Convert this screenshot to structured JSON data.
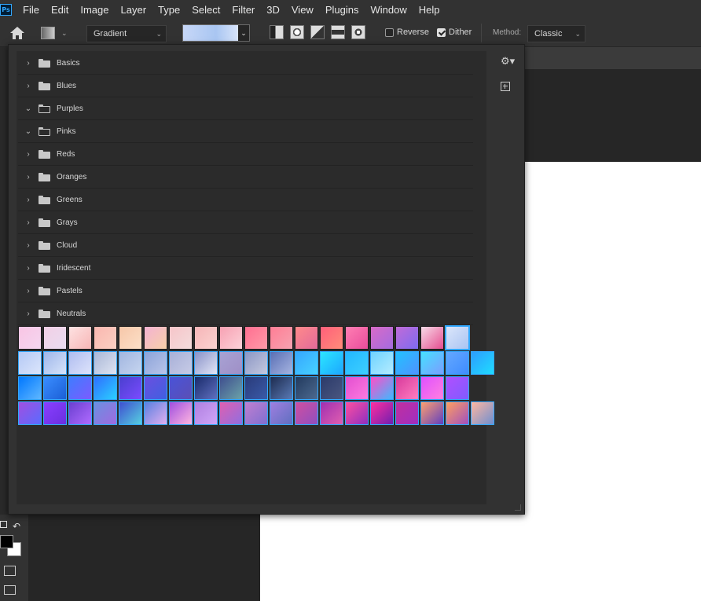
{
  "app": {
    "logo_text": "Ps"
  },
  "menu": [
    "File",
    "Edit",
    "Image",
    "Layer",
    "Type",
    "Select",
    "Filter",
    "3D",
    "View",
    "Plugins",
    "Window",
    "Help"
  ],
  "options_bar": {
    "gradient_type": "Gradient",
    "reverse_label": "Reverse",
    "reverse_checked": false,
    "dither_label": "Dither",
    "dither_checked": true,
    "method_label": "Method:",
    "method_value": "Classic"
  },
  "gradient_panel": {
    "folders": [
      {
        "name": "Basics",
        "expanded": false
      },
      {
        "name": "Blues",
        "expanded": false
      },
      {
        "name": "Purples",
        "expanded": true
      },
      {
        "name": "Pinks",
        "expanded": true
      },
      {
        "name": "Reds",
        "expanded": false
      },
      {
        "name": "Oranges",
        "expanded": false
      },
      {
        "name": "Greens",
        "expanded": false
      },
      {
        "name": "Grays",
        "expanded": false
      },
      {
        "name": "Cloud",
        "expanded": false
      },
      {
        "name": "Iridescent",
        "expanded": false
      },
      {
        "name": "Pastels",
        "expanded": false
      },
      {
        "name": "Neutrals",
        "expanded": false
      }
    ],
    "swatches": [
      [
        "#f9c5e4,#f4d6f0",
        "#f2d0e6,#e9dcf0",
        "#fde2e2,#f7b6b6",
        "#f9b7b0,#fbd0c2",
        "#f7c7a9,#fce0c8",
        "#f4b2d2,#f6d0a8",
        "#f6c5c9,#f3dcdc",
        "#f6b5b8,#fbd3d0",
        "#f7a1b3,#fcd1d8",
        "#ff6f91,#ff9aa8",
        "#ff7e95,#f6a2b0",
        "#ff8a8a,#e26a9a",
        "#ff5f7a,#ff8c7a",
        "#ff7eb3,#e94d9b",
        "#d86bc7,#a46be0",
        "#c06bd8,#7e6bf0",
        "#f7dbe8,#e64c8f",
        "#dbe6fb,#aac4f2"
      ],
      [
        "#b5c9f5,#dbe5fb",
        "#9fb6ea,#d7e4fa",
        "#b0bdf0,#dde3fb",
        "#aab7d6,#dee4f2",
        "#a2b6e0,#c6d5ef",
        "#8ca3d9,#b9c5e9",
        "#a8b0d8,#c7cbe6",
        "#8a92c8,#e2e6f6",
        "#a8a2d4,#9f8fc6",
        "#8c96c4,#c4c9df",
        "#5a6fb5,#a6b4e0",
        "#35a7ff,#47d1ff",
        "#2ce5ff,#1ca8ff",
        "#22b8ff,#3dcfff",
        "#6fd3ff,#b4ecff",
        "#22c1ff,#4f93ff",
        "#46e0ff,#7b9dff",
        "#63a8ff,#3f8cff",
        "#2d9dff,#1fdcff"
      ],
      [
        "#0077ff,#5fb7ff",
        "#3a8dff,#1b5fd6",
        "#3f7cff,#7b5cff",
        "#2f6fff,#2ad0ff",
        "#4a3fcf,#7b4cff",
        "#6a4fe0,#4060e0",
        "#4953d8,#5b4fb5",
        "#1a2b6b,#6070c0",
        "#3f4f8f,#6ba3a8",
        "#2a3b7a,#3a5aa8",
        "#1d2b4f,#5a7ab5",
        "#223a5e,#4d6a90",
        "#2c3a6a,#4a5780",
        "#e24fd0,#ff7be0",
        "#ff4fc8,#3fb8ff",
        "#d83a9c,#ff7ec0",
        "#e050ff,#ff80e0",
        "#b04fff,#7f5cff"
      ],
      [
        "#a04fe0,#5a6bff",
        "#8a3fff,#6a2fe0",
        "#6a3fd0,#b06bff",
        "#6b8fe0,#9f6be0",
        "#3f4fd0,#56d0e0",
        "#5a7fe0,#e0b0f0",
        "#a04fe0,#ffb6e0",
        "#b07fe0,#d0a6f8",
        "#e05fb0,#8f6fe0",
        "#c07fd0,#7f6fd0",
        "#9f7fe0,#606fc0",
        "#d04fa0,#8f4fc0",
        "#a02fb0,#e05fb0",
        "#ff4fa0,#8f2fc0",
        "#ff2f9f,#6f1fb0",
        "#c02f9f,#a02fc0",
        "#ff9f6f,#5f3fc0",
        "#ff9f5f,#a04fc0",
        "#ffb6a0,#6f8fd0"
      ]
    ]
  }
}
